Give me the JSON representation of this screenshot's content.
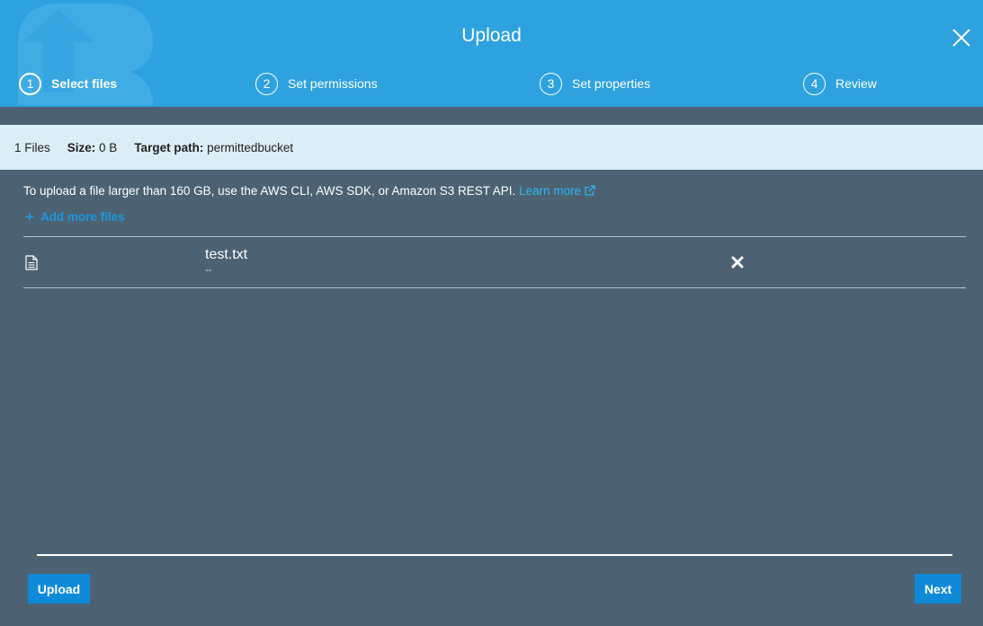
{
  "header": {
    "title": "Upload",
    "steps": [
      {
        "num": "1",
        "label": "Select files",
        "active": true
      },
      {
        "num": "2",
        "label": "Set permissions",
        "active": false
      },
      {
        "num": "3",
        "label": "Set properties",
        "active": false
      },
      {
        "num": "4",
        "label": "Review",
        "active": false
      }
    ]
  },
  "summary": {
    "files": "1 Files",
    "size_label": "Size:",
    "size_value": "0 B",
    "path_label": "Target path:",
    "path_value": "permittedbucket"
  },
  "notice": {
    "text": "To upload a file larger than 160 GB, use the AWS CLI, AWS SDK, or Amazon S3 REST API.",
    "link": "Learn more"
  },
  "add_more": {
    "icon": "+",
    "label": "Add more files"
  },
  "files": [
    {
      "name": "test.txt",
      "size": "--"
    }
  ],
  "buttons": {
    "upload": "Upload",
    "next": "Next"
  },
  "colors": {
    "header": "#2da2df",
    "body": "#4c6272",
    "infobar": "#dbeef7",
    "link": "#2db4f0",
    "button": "#0e8ad8"
  }
}
